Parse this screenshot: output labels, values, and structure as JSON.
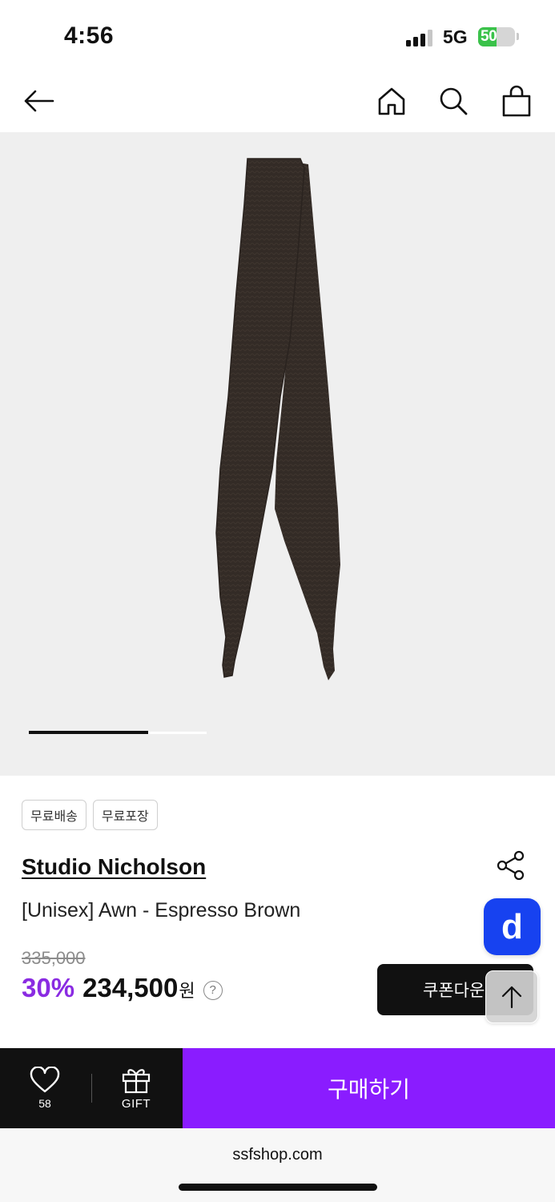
{
  "status_bar": {
    "time": "4:56",
    "network": "5G",
    "battery_level": "50"
  },
  "nav": {
    "icons": [
      "back-arrow-icon",
      "home-icon",
      "search-icon",
      "shopping-bag-icon"
    ]
  },
  "gallery": {
    "image_description_icon": "scarf-image",
    "progress_fraction": 0.67
  },
  "product": {
    "tags": [
      "무료배송",
      "무료포장"
    ],
    "brand": "Studio Nicholson",
    "name": "[Unisex] Awn - Espresso Brown",
    "original_price": "335,000",
    "discount": "30%",
    "price": "234,500",
    "currency": "원",
    "help_label": "?",
    "coupon_button": "쿠폰다운",
    "app_badge": "d"
  },
  "bottom_bar": {
    "wishlist_count": "58",
    "gift_label": "GIFT",
    "buy_label": "구매하기"
  },
  "browser": {
    "url": "ssfshop.com"
  },
  "colors": {
    "accent_purple": "#8a1cff",
    "discount_purple": "#8a2be2",
    "badge_blue": "#1742f0"
  }
}
